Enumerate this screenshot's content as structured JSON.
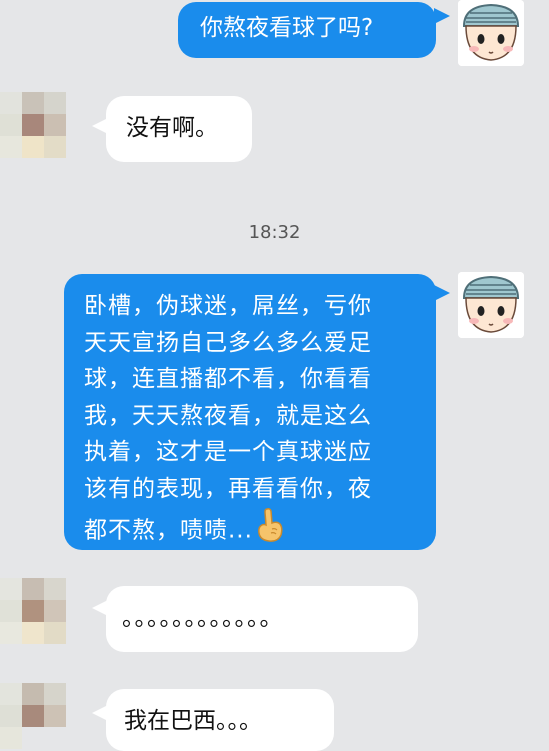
{
  "timestamp": "18:32",
  "messages": [
    {
      "id": "msg-1",
      "side": "right",
      "text": "你熬夜看球了吗?"
    },
    {
      "id": "msg-2",
      "side": "left",
      "text": "没有啊。"
    },
    {
      "id": "msg-3",
      "side": "right",
      "lines": [
        "卧槽，伪球迷，屌丝，亏你",
        "天天宣扬自己多么多么爱足",
        "球，连直播都不看，你看看",
        "我，天天熬夜看，就是这么",
        "执着，这才是一个真球迷应",
        "该有的表现，再看看你，夜",
        "都不熬，啧啧..."
      ],
      "trailing_emoji": "pointing-finger-icon"
    },
    {
      "id": "msg-4",
      "side": "left",
      "text": "。。。。。。。。。。。。"
    },
    {
      "id": "msg-5",
      "side": "left",
      "text": "我在巴西。。。"
    }
  ],
  "colors": {
    "outgoing_bubble": "#1a8cec",
    "incoming_bubble": "#ffffff",
    "background": "#e5e6e8"
  }
}
